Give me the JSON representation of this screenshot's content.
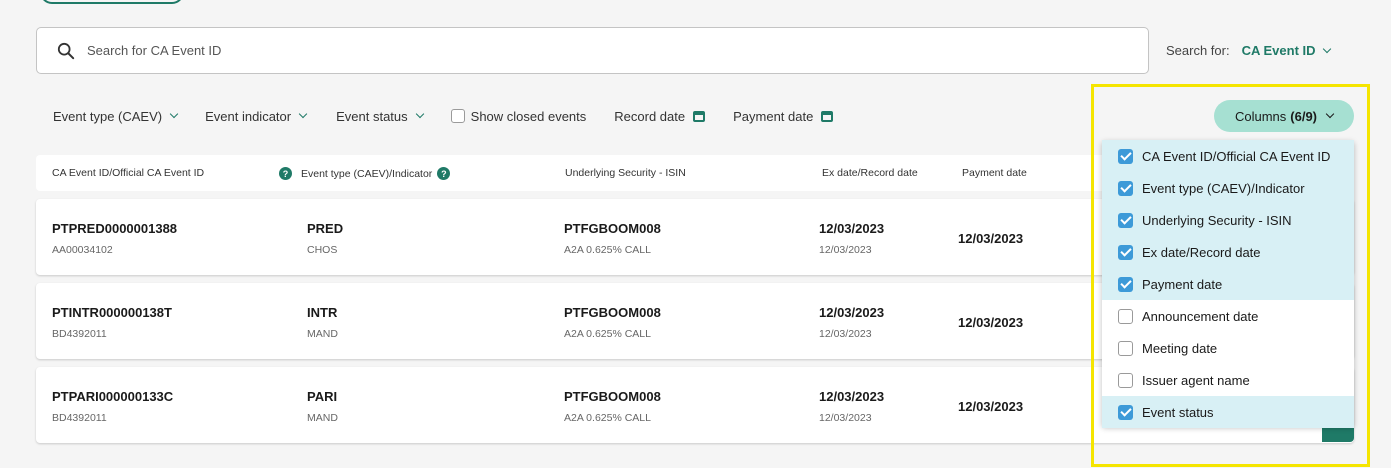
{
  "search": {
    "placeholder": "Search for CA Event ID",
    "for_label": "Search for:",
    "for_value": "CA Event ID"
  },
  "filters": {
    "event_type": "Event type (CAEV)",
    "event_indicator": "Event indicator",
    "event_status": "Event status",
    "show_closed": "Show closed events",
    "record_date": "Record date",
    "payment_date": "Payment date"
  },
  "columns_button": {
    "label": "Columns",
    "count": "(6/9)"
  },
  "table": {
    "headers": {
      "id": "CA Event ID/Official CA Event ID",
      "type": "Event type (CAEV)/Indicator",
      "security": "Underlying Security - ISIN",
      "ex_date": "Ex date/Record date",
      "payment": "Payment date"
    },
    "rows": [
      {
        "id": "PTPRED0000001388",
        "official_id": "AA00034102",
        "type": "PRED",
        "indicator": "CHOS",
        "isin": "PTFGBOOM008",
        "security": "A2A 0.625% CALL",
        "ex_date": "12/03/2023",
        "record_date": "12/03/2023",
        "payment_date": "12/03/2023"
      },
      {
        "id": "PTINTR000000138T",
        "official_id": "BD4392011",
        "type": "INTR",
        "indicator": "MAND",
        "isin": "PTFGBOOM008",
        "security": "A2A 0.625% CALL",
        "ex_date": "12/03/2023",
        "record_date": "12/03/2023",
        "payment_date": "12/03/2023"
      },
      {
        "id": "PTPARI000000133C",
        "official_id": "BD4392011",
        "type": "PARI",
        "indicator": "MAND",
        "isin": "PTFGBOOM008",
        "security": "A2A 0.625% CALL",
        "ex_date": "12/03/2023",
        "record_date": "12/03/2023",
        "payment_date": "12/03/2023"
      }
    ]
  },
  "column_options": [
    {
      "label": "CA Event ID/Official CA Event ID",
      "checked": true
    },
    {
      "label": "Event type (CAEV)/Indicator",
      "checked": true
    },
    {
      "label": "Underlying Security - ISIN",
      "checked": true
    },
    {
      "label": "Ex date/Record date",
      "checked": true
    },
    {
      "label": "Payment date",
      "checked": true
    },
    {
      "label": "Announcement date",
      "checked": false
    },
    {
      "label": "Meeting date",
      "checked": false
    },
    {
      "label": "Issuer agent name",
      "checked": false
    },
    {
      "label": "Event status",
      "checked": true
    }
  ],
  "colors": {
    "accent": "#1f7a67",
    "button_bg": "#a6e0d2",
    "checkbox": "#3d9ad8",
    "highlight": "#f5e500"
  }
}
